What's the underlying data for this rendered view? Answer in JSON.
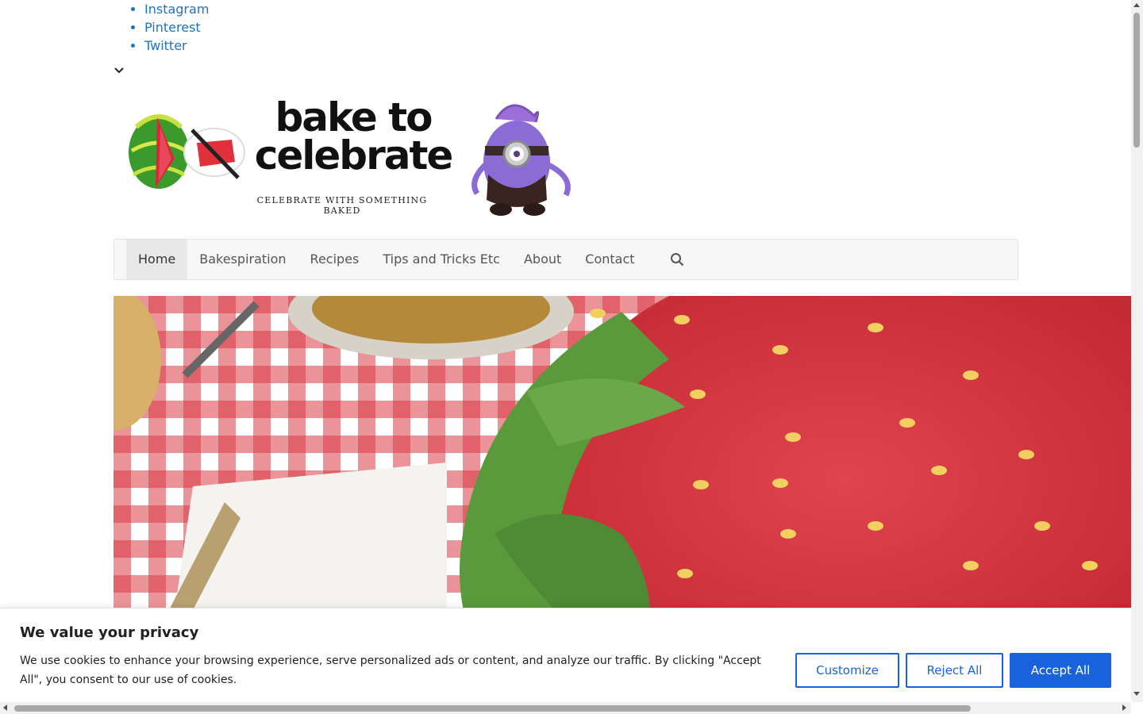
{
  "social": {
    "links": [
      "Instagram",
      "Pinterest",
      "Twitter"
    ]
  },
  "logo": {
    "title_line1": "bake to",
    "title_line2": "celebrate",
    "tagline": "CELEBRATE WITH SOMETHING BAKED"
  },
  "nav": {
    "items": [
      "Home",
      "Bakespiration",
      "Recipes",
      "Tips and Tricks Etc",
      "About",
      "Contact"
    ],
    "active": "Home",
    "search_icon": "search-icon"
  },
  "cookie": {
    "title": "We value your privacy",
    "text": "We use cookies to enhance your browsing experience, serve personalized ads or content, and analyze our traffic. By clicking \"Accept All\", you consent to our use of cookies.",
    "customize_label": "Customize",
    "reject_label": "Reject All",
    "accept_label": "Accept All"
  },
  "colors": {
    "link": "#1e73be",
    "accent": "#1863dc"
  }
}
